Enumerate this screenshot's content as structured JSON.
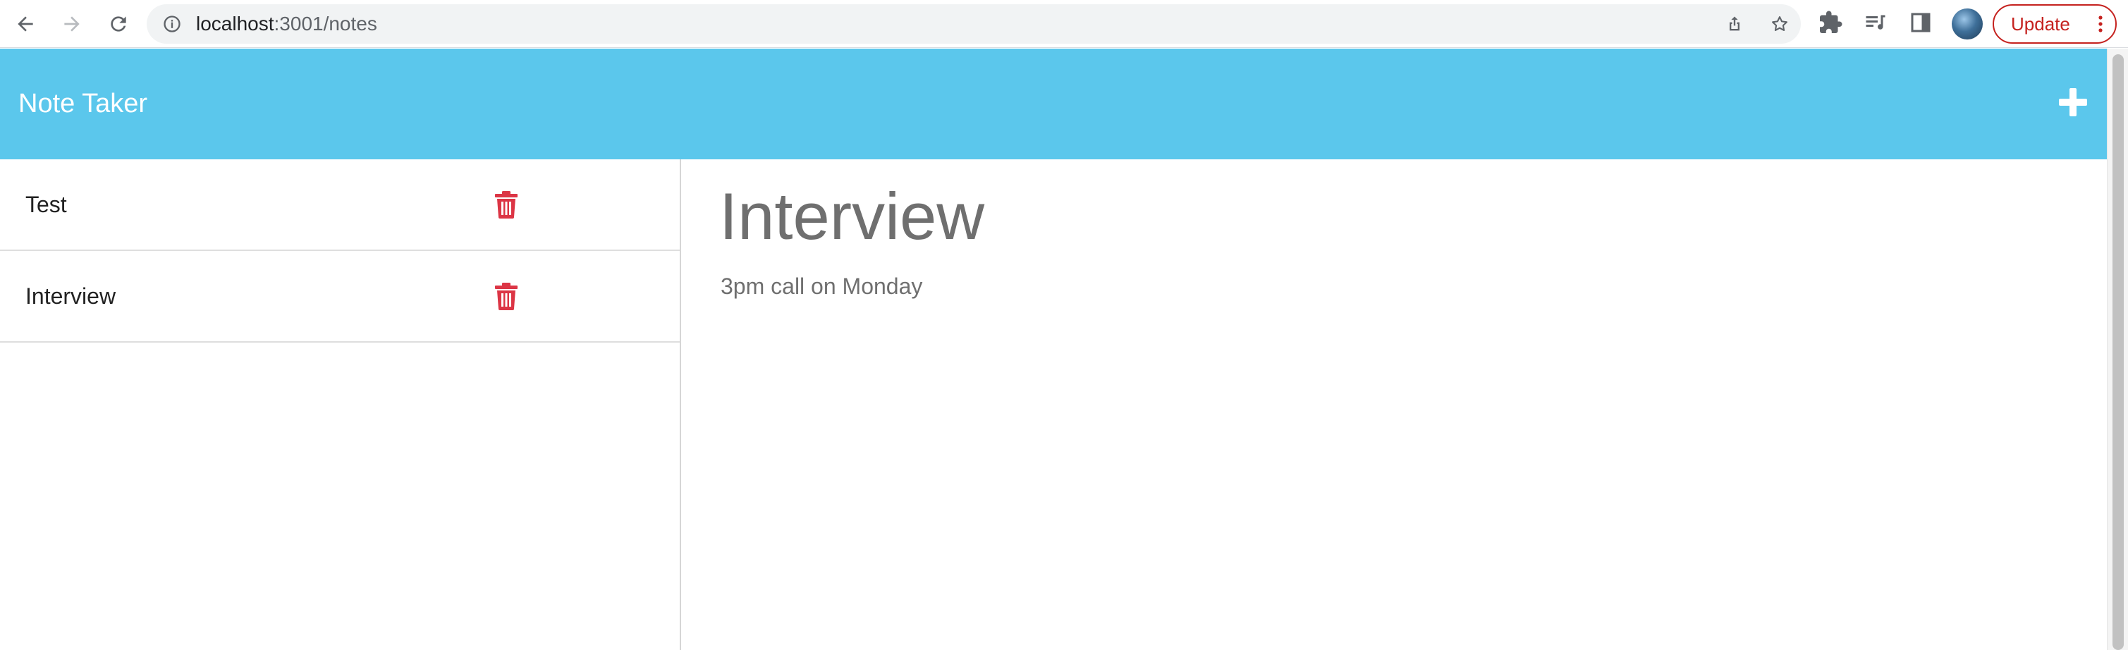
{
  "browser": {
    "url_host": "localhost",
    "url_path": ":3001/notes",
    "update_label": "Update",
    "icons": {
      "back": "back-arrow-icon",
      "forward": "forward-arrow-icon",
      "reload": "reload-icon",
      "site_info": "info-icon",
      "share": "share-icon",
      "bookmark": "star-icon",
      "extensions": "puzzle-icon",
      "media": "media-control-icon",
      "side_panel": "side-panel-icon",
      "menu": "kebab-menu-icon"
    }
  },
  "app": {
    "title": "Note Taker",
    "add_icon": "plus-icon",
    "colors": {
      "header": "#5bc7ec",
      "delete": "#dc3545",
      "text_muted": "#6f6f6f"
    }
  },
  "notes": [
    {
      "title": "Test",
      "delete_icon": "trash-icon"
    },
    {
      "title": "Interview",
      "delete_icon": "trash-icon"
    }
  ],
  "active_note": {
    "title": "Interview",
    "text": "3pm call on Monday"
  }
}
